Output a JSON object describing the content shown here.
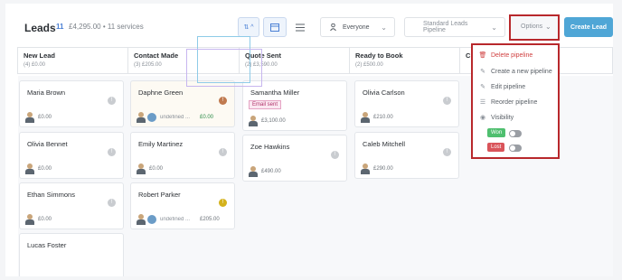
{
  "header": {
    "title": "Leads",
    "count": "11",
    "meta": "£4,295.00 • 11 services",
    "sort_icon": "⇅ ^",
    "owner_filter": "Everyone",
    "pipeline": "Standard Leads Pipeline",
    "options_label": "Options",
    "create_label": "Create Lead"
  },
  "columns": [
    {
      "name": "New Lead",
      "sub": "(4) £0.00"
    },
    {
      "name": "Contact Made",
      "sub": "(3) £205.00"
    },
    {
      "name": "Quote Sent",
      "sub": "(2) £3,590.00"
    },
    {
      "name": "Ready to Book",
      "sub": "(2) £500.00"
    },
    {
      "name": "C",
      "sub": ""
    }
  ],
  "cards": {
    "maria": {
      "name": "Maria Brown",
      "amount": "£0.00"
    },
    "olivia_b": {
      "name": "Olivia Bennet",
      "amount": "£0.00"
    },
    "ethan": {
      "name": "Ethan Simmons",
      "amount": "£0.00"
    },
    "lucas": {
      "name": "Lucas Foster"
    },
    "daphne": {
      "name": "Daphne Green",
      "who": "undefined ...",
      "amount": "£0.00"
    },
    "emily": {
      "name": "Emily Martinez",
      "amount": "£0.00"
    },
    "robert": {
      "name": "Robert Parker",
      "who": "undefined ...",
      "amount": "£205.00"
    },
    "samantha": {
      "name": "Samantha Miller",
      "tag": "Email sent",
      "amount": "£3,100.00"
    },
    "zoe": {
      "name": "Zoe Hawkins",
      "amount": "£490.00"
    },
    "olivia_c": {
      "name": "Olivia Carlson",
      "amount": "£210.00"
    },
    "caleb": {
      "name": "Caleb Mitchell",
      "amount": "£290.00"
    }
  },
  "menu": {
    "delete": "Delete pipeline",
    "create": "Create a new pipeline",
    "edit": "Edit pipeline",
    "reorder": "Reorder pipeline",
    "visibility": "Visibility",
    "won": "Won",
    "lost": "Lost"
  },
  "colors": {
    "accent": "#4fa6d6",
    "won": "#4fbf6f",
    "lost": "#d9545a",
    "highlight": "#b8282c"
  }
}
